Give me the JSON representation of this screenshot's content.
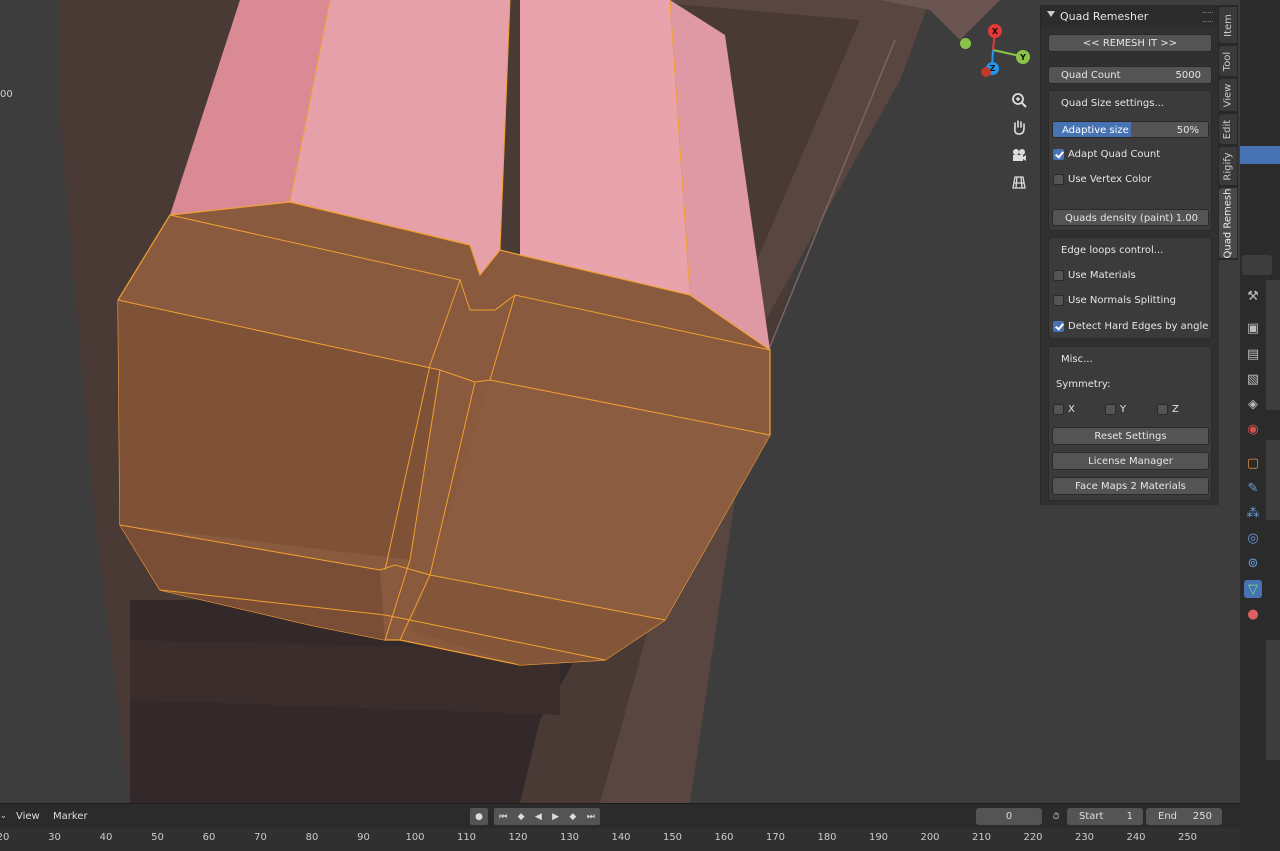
{
  "viewport": {
    "left_number": "00"
  },
  "gizmo": {
    "x": "X",
    "y": "Y",
    "z": "Z"
  },
  "nav_icons": [
    "zoom-icon",
    "hand-pan-icon",
    "camera-icon",
    "grid-ortho-icon"
  ],
  "quad_remesher": {
    "title": "Quad Remesher",
    "remesh_button": "<<  REMESH IT  >>",
    "quad_count": {
      "label": "Quad Count",
      "value": "5000"
    },
    "quad_size": {
      "header": "Quad Size settings...",
      "adaptive": {
        "label": "Adaptive size",
        "value": "50%",
        "percent": 50
      },
      "adapt_quad_count": {
        "label": "Adapt Quad Count",
        "checked": true
      },
      "use_vertex_color": {
        "label": "Use Vertex Color",
        "checked": false
      },
      "density": {
        "label": "Quads density (paint)",
        "value": "1.00"
      }
    },
    "edge_loops": {
      "header": "Edge loops control...",
      "use_materials": {
        "label": "Use Materials",
        "checked": false
      },
      "use_normals": {
        "label": "Use Normals Splitting",
        "checked": false
      },
      "detect_hard": {
        "label": "Detect Hard Edges by angle",
        "checked": true
      }
    },
    "misc": {
      "header": "Misc...",
      "symmetry": "Symmetry:",
      "x": "X",
      "y": "Y",
      "z": "Z",
      "reset": "Reset Settings",
      "license": "License Manager",
      "facemaps": "Face Maps 2 Materials"
    }
  },
  "side_tabs": [
    "Item",
    "Tool",
    "View",
    "Edit",
    "Rigify",
    "Quad Remesh"
  ],
  "active_tab": "Quad Remesh",
  "timeline": {
    "view": "View",
    "marker": "Marker",
    "current_frame": "0",
    "start_label": "Start",
    "start_value": "1",
    "end_label": "End",
    "end_value": "250",
    "ticks": [
      "20",
      "30",
      "40",
      "50",
      "60",
      "70",
      "80",
      "90",
      "100",
      "110",
      "120",
      "130",
      "140",
      "150",
      "160",
      "170",
      "180",
      "190",
      "200",
      "210",
      "220",
      "230",
      "240",
      "250"
    ]
  }
}
